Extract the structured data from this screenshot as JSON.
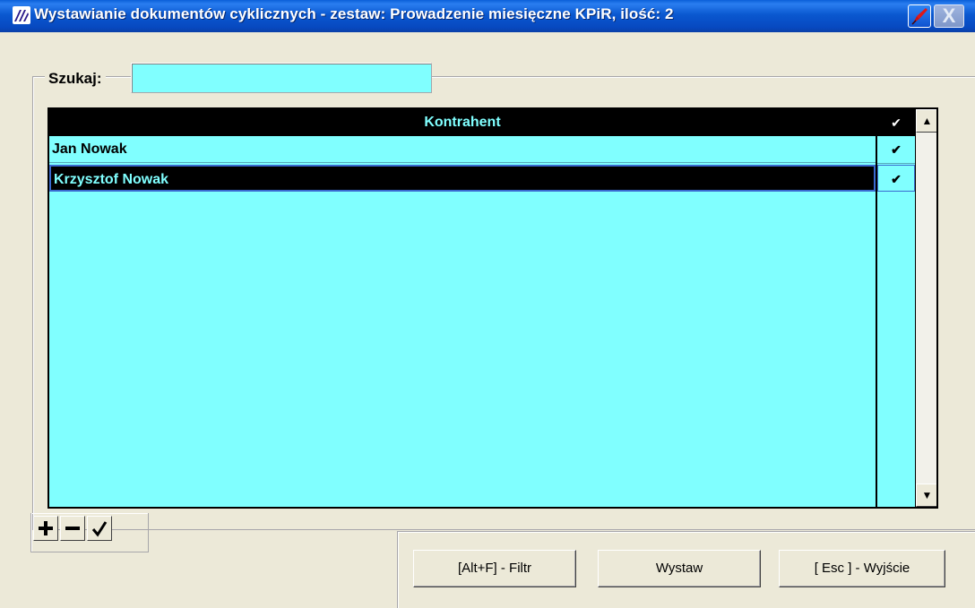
{
  "window": {
    "title": "Wystawianie dokumentów cyklicznych - zestaw: Prowadzenie miesięczne KPiR, ilość: 2",
    "help_icon": "help-pen-icon",
    "close_icon": "close-icon",
    "close_label": "X"
  },
  "search": {
    "label": "Szukaj:",
    "value": ""
  },
  "grid": {
    "column_header": "Kontrahent",
    "check_header": "✔",
    "rows": [
      {
        "name": "Jan Nowak",
        "checked": "✔"
      },
      {
        "name": "Krzysztof Nowak",
        "checked": "✔"
      }
    ],
    "scroll_up": "▲",
    "scroll_down": "▼",
    "selected_row": 1
  },
  "toolbar": {
    "add_icon": "plus-icon",
    "remove_icon": "minus-icon",
    "toggle_icon": "check-toggle-icon"
  },
  "buttons": {
    "filter": "[Alt+F] - Filtr",
    "issue": "Wystaw",
    "exit": "[ Esc ] - Wyjście"
  },
  "colors": {
    "grid_background": "#80ffff",
    "header_background": "#000000",
    "title_bar": "#0a58d0"
  }
}
